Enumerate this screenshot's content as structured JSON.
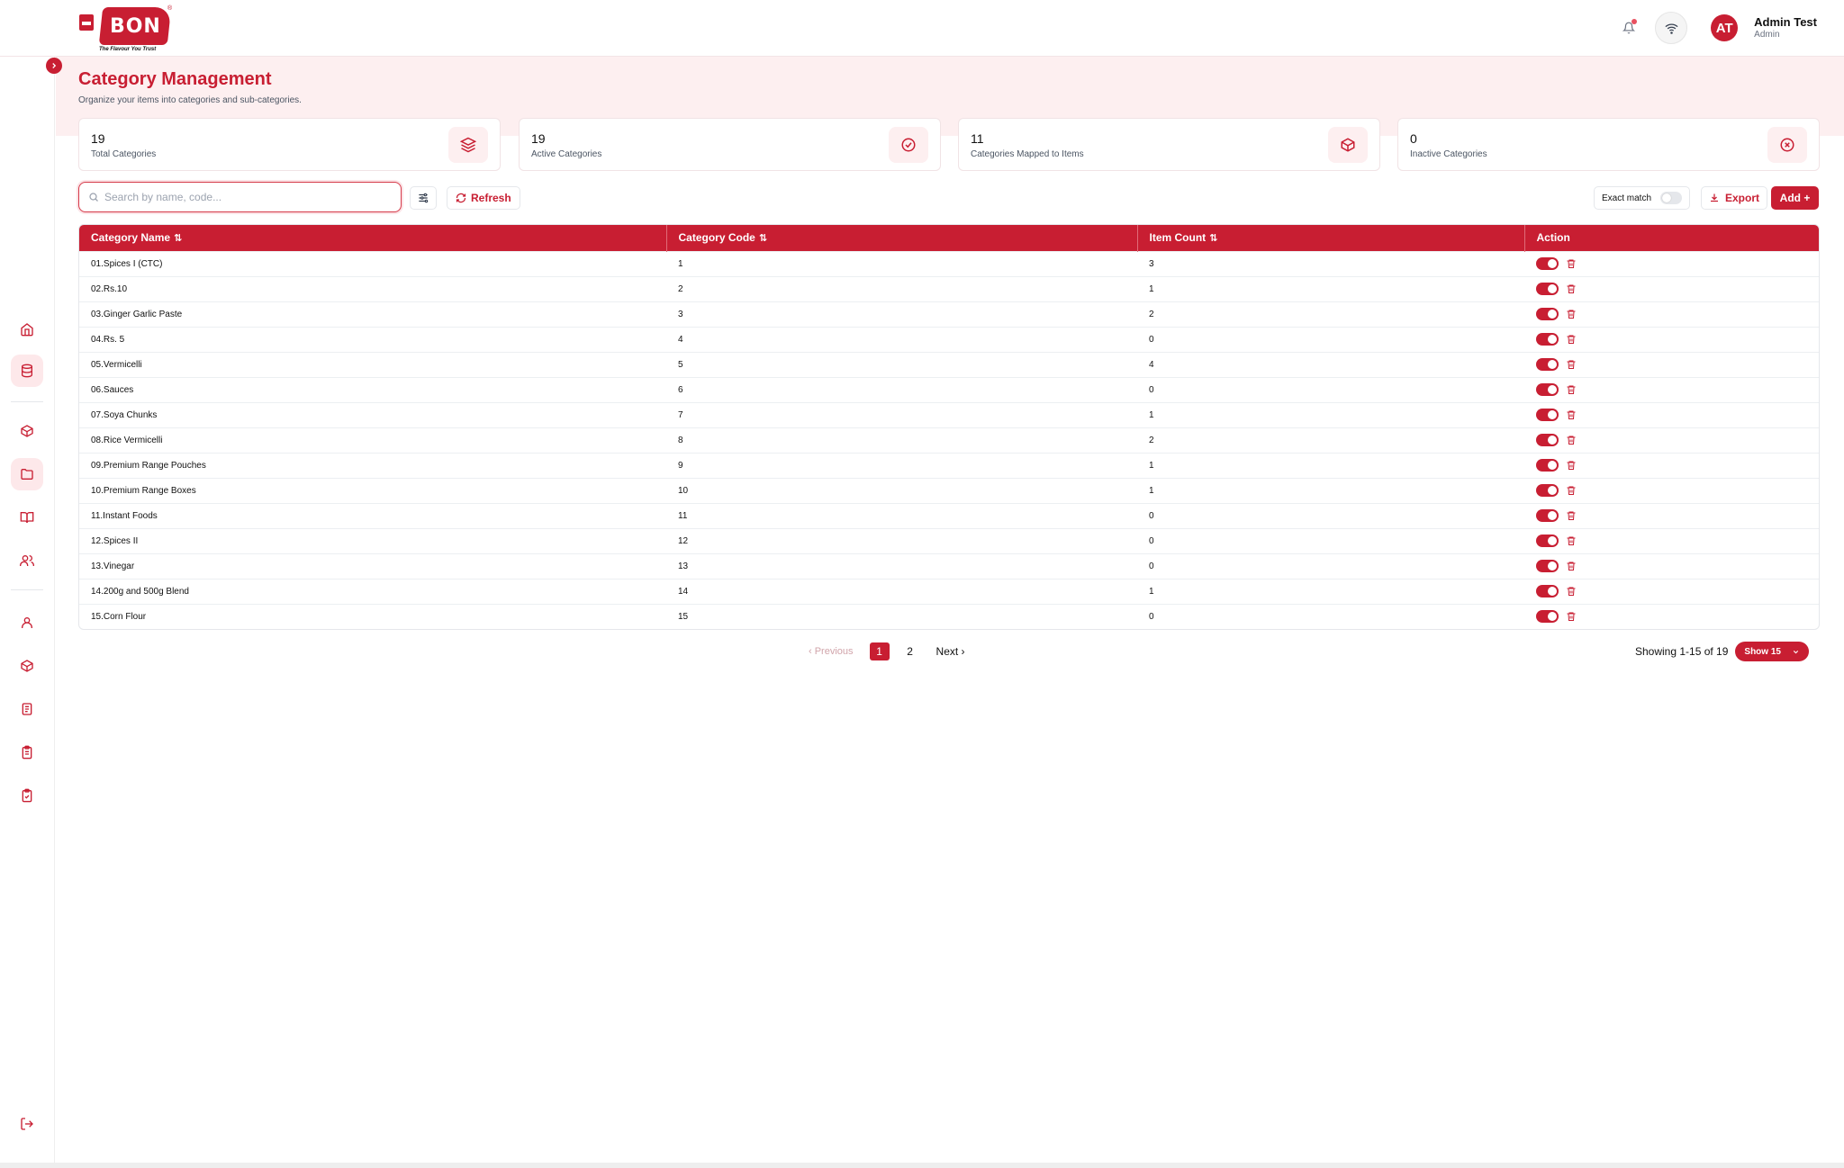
{
  "brand": {
    "logo_text": "BON",
    "tagline": "The Flavour You Trust"
  },
  "header": {
    "user_name": "Admin Test",
    "user_role": "Admin",
    "avatar_initials": "AT"
  },
  "page": {
    "title": "Category Management",
    "subtitle": "Organize your items into categories and sub-categories."
  },
  "stats": [
    {
      "value": "19",
      "label": "Total Categories",
      "icon": "layers-icon"
    },
    {
      "value": "19",
      "label": "Active Categories",
      "icon": "check-circle-icon"
    },
    {
      "value": "11",
      "label": "Categories Mapped to Items",
      "icon": "box-icon"
    },
    {
      "value": "0",
      "label": "Inactive Categories",
      "icon": "x-circle-icon"
    }
  ],
  "toolbar": {
    "search_placeholder": "Search by name, code...",
    "search_value": "",
    "refresh_label": "Refresh",
    "exact_match_label": "Exact match",
    "export_label": "Export",
    "add_label": "Add +"
  },
  "table": {
    "columns": [
      "Category Name",
      "Category Code",
      "Item Count",
      "Action"
    ],
    "rows": [
      {
        "name": "01.Spices I (CTC)",
        "code": "1",
        "count": "3"
      },
      {
        "name": "02.Rs.10",
        "code": "2",
        "count": "1"
      },
      {
        "name": "03.Ginger Garlic Paste",
        "code": "3",
        "count": "2"
      },
      {
        "name": "04.Rs. 5",
        "code": "4",
        "count": "0"
      },
      {
        "name": "05.Vermicelli",
        "code": "5",
        "count": "4"
      },
      {
        "name": "06.Sauces",
        "code": "6",
        "count": "0"
      },
      {
        "name": "07.Soya Chunks",
        "code": "7",
        "count": "1"
      },
      {
        "name": "08.Rice Vermicelli",
        "code": "8",
        "count": "2"
      },
      {
        "name": "09.Premium Range Pouches",
        "code": "9",
        "count": "1"
      },
      {
        "name": "10.Premium Range Boxes",
        "code": "10",
        "count": "1"
      },
      {
        "name": "11.Instant Foods",
        "code": "11",
        "count": "0"
      },
      {
        "name": "12.Spices II",
        "code": "12",
        "count": "0"
      },
      {
        "name": "13.Vinegar",
        "code": "13",
        "count": "0"
      },
      {
        "name": "14.200g and 500g Blend",
        "code": "14",
        "count": "1"
      },
      {
        "name": "15.Corn Flour",
        "code": "15",
        "count": "0"
      }
    ]
  },
  "pagination": {
    "previous_label": "‹ Previous",
    "pages": [
      "1",
      "2"
    ],
    "current": "1",
    "next_label": "Next ›",
    "showing_text": "Showing 1-15 of 19",
    "page_size_label": "Show 15"
  },
  "colors": {
    "accent": "#c81e32",
    "hero_bg": "#fdeff0"
  }
}
